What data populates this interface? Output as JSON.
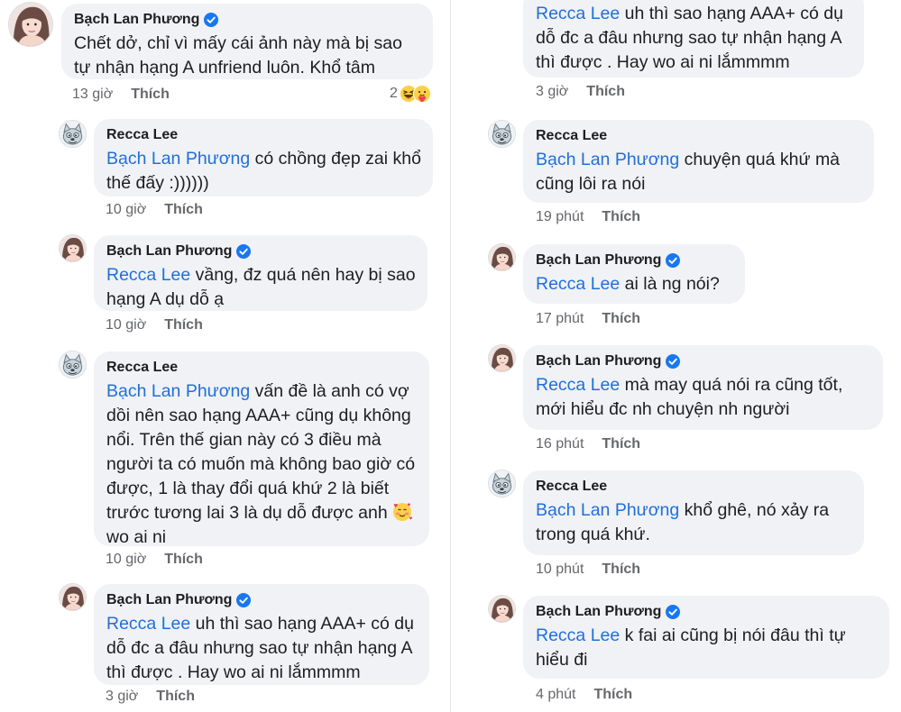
{
  "comments": [
    {
      "id": "c1",
      "author": "Bạch Lan Phương",
      "verified": true,
      "mention": "",
      "text": "Chết dở, chỉ vì mấy cái ảnh này mà bị sao tự nhận hạng A unfriend luôn. Khổ tâm",
      "time": "13 giờ",
      "like": "Thích",
      "reaction_count": "2"
    },
    {
      "id": "c2",
      "author": "Recca Lee",
      "verified": false,
      "mention": "Bạch Lan Phương",
      "text": " có chồng đẹp zai khổ thế đấy :))))))",
      "time": "10 giờ",
      "like": "Thích"
    },
    {
      "id": "c3",
      "author": "Bạch Lan Phương",
      "verified": true,
      "mention": "Recca Lee",
      "text": " vầng, đz quá nên hay bị sao hạng A dụ dỗ ạ",
      "time": "10 giờ",
      "like": "Thích"
    },
    {
      "id": "c4",
      "author": "Recca Lee",
      "verified": false,
      "mention": "Bạch Lan Phương",
      "text": "  vấn đề là anh có vợ dồi nên sao hạng AAA+ cũng dụ không nổi. Trên thế gian này có 3 điều mà người ta có muốn mà không bao giờ có được, 1 là thay đổi quá khứ 2 là biết trước tương lai 3 là dụ dỗ được anh",
      "text_after_emoji": " wo ai ni",
      "time": "10 giờ",
      "like": "Thích"
    },
    {
      "id": "c5",
      "author": "Bạch Lan Phương",
      "verified": true,
      "mention": "Recca Lee",
      "text": " uh thì sao hạng AAA+ có dụ dỗ đc a đâu nhưng sao tự nhận hạng A thì được . Hay wo ai ni lắmmmm",
      "time": "3 giờ",
      "like": "Thích"
    },
    {
      "id": "c6",
      "author": "Recca Lee",
      "verified": false,
      "mention": "",
      "text": "uh thì sao hạng AAA+ có dụ dỗ đc a đâu nhưng sao tự nhận hạng A thì được . Hay wo ai ni lắmmmm",
      "time": "3 giờ",
      "like": "Thích"
    },
    {
      "id": "c7",
      "author": "Recca Lee",
      "verified": false,
      "mention": "Bạch Lan Phương",
      "text": " chuyện quá khứ mà cũng lôi ra nói",
      "time": "19 phút",
      "like": "Thích"
    },
    {
      "id": "c8",
      "author": "Bạch Lan Phương",
      "verified": true,
      "mention": "Recca Lee",
      "text": " ai là ng nói?",
      "time": "17 phút",
      "like": "Thích"
    },
    {
      "id": "c9",
      "author": "Bạch Lan Phương",
      "verified": true,
      "mention": "Recca Lee",
      "text": " mà may quá nói ra cũng tốt, mới hiểu đc nh chuyện nh người",
      "time": "16 phút",
      "like": "Thích"
    },
    {
      "id": "c10",
      "author": "Recca Lee",
      "verified": false,
      "mention": "Bạch Lan Phương",
      "text": " khổ ghê, nó xảy ra trong quá khứ.",
      "time": "10 phút",
      "like": "Thích"
    },
    {
      "id": "c11",
      "author": "Bạch Lan Phương",
      "verified": true,
      "mention": "Recca Lee",
      "text": "  k fai ai cũng bị nói đâu thì tự hiểu đi",
      "time": "4 phút",
      "like": "Thích"
    }
  ],
  "icons": {
    "verified": "verified-badge-icon",
    "haha": "haha-reaction-icon",
    "care": "care-reaction-icon",
    "hearts_face": "smiling-face-with-hearts-icon"
  },
  "colors": {
    "mention": "#216fdb",
    "bubble": "#f0f2f5",
    "verified": "#1877f2",
    "meta": "#65676b"
  }
}
